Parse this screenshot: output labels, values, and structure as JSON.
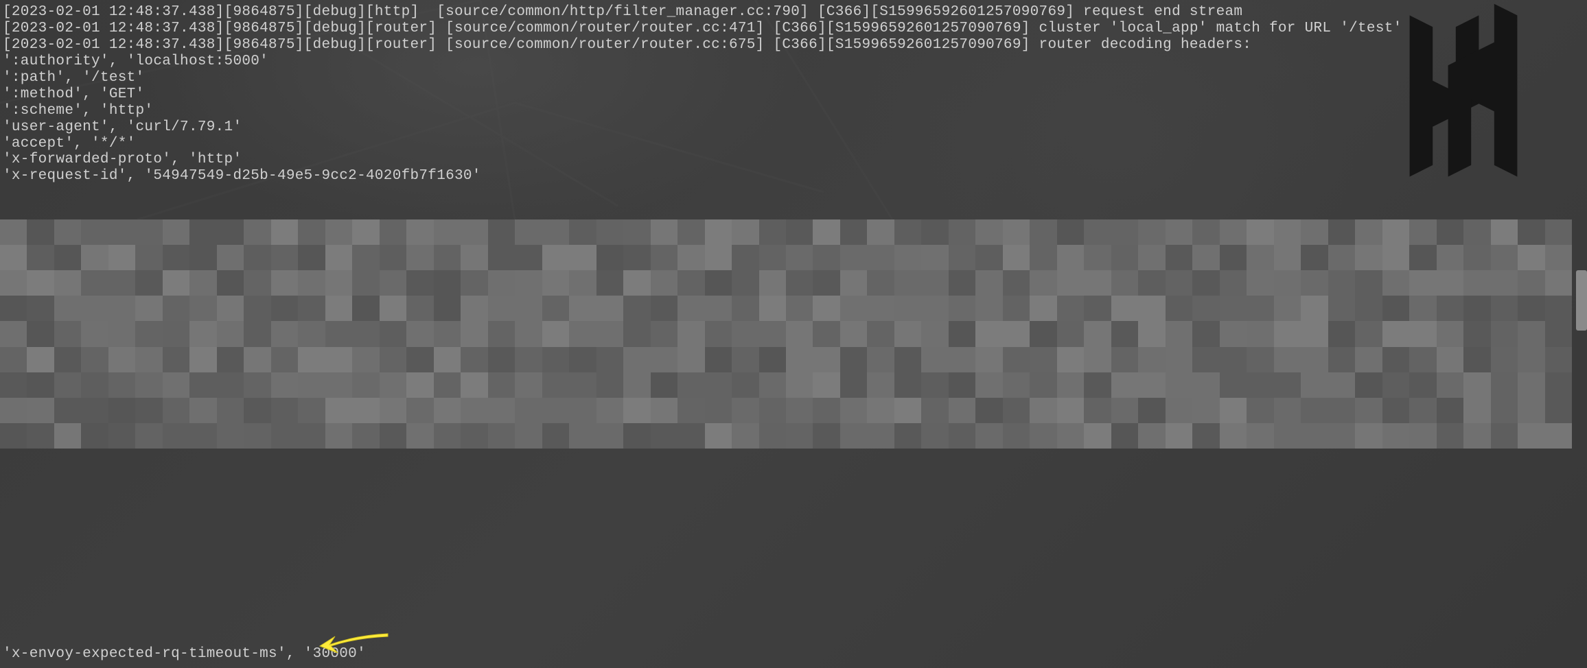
{
  "log_lines": [
    "[2023-02-01 12:48:37.438][9864875][debug][http]  [source/common/http/filter_manager.cc:790] [C366][S15996592601257090769] request end stream",
    "[2023-02-01 12:48:37.438][9864875][debug][router] [source/common/router/router.cc:471] [C366][S15996592601257090769] cluster 'local_app' match for URL '/test'",
    "[2023-02-01 12:48:37.438][9864875][debug][router] [source/common/router/router.cc:675] [C366][S15996592601257090769] router decoding headers:",
    "':authority', 'localhost:5000'",
    "':path', '/test'",
    "':method', 'GET'",
    "':scheme', 'http'",
    "'user-agent', 'curl/7.79.1'",
    "'accept', '*/*'",
    "'x-forwarded-proto', 'http'",
    "'x-request-id', '54947549-d25b-49e5-9cc2-4020fb7f1630'"
  ],
  "footer_line": "'x-envoy-expected-rq-timeout-ms', '30000'",
  "colors": {
    "background": "#3d3d3d",
    "text": "#d0d0d0",
    "arrow": "#ffeb3b",
    "logo": "#1a1a1a"
  }
}
